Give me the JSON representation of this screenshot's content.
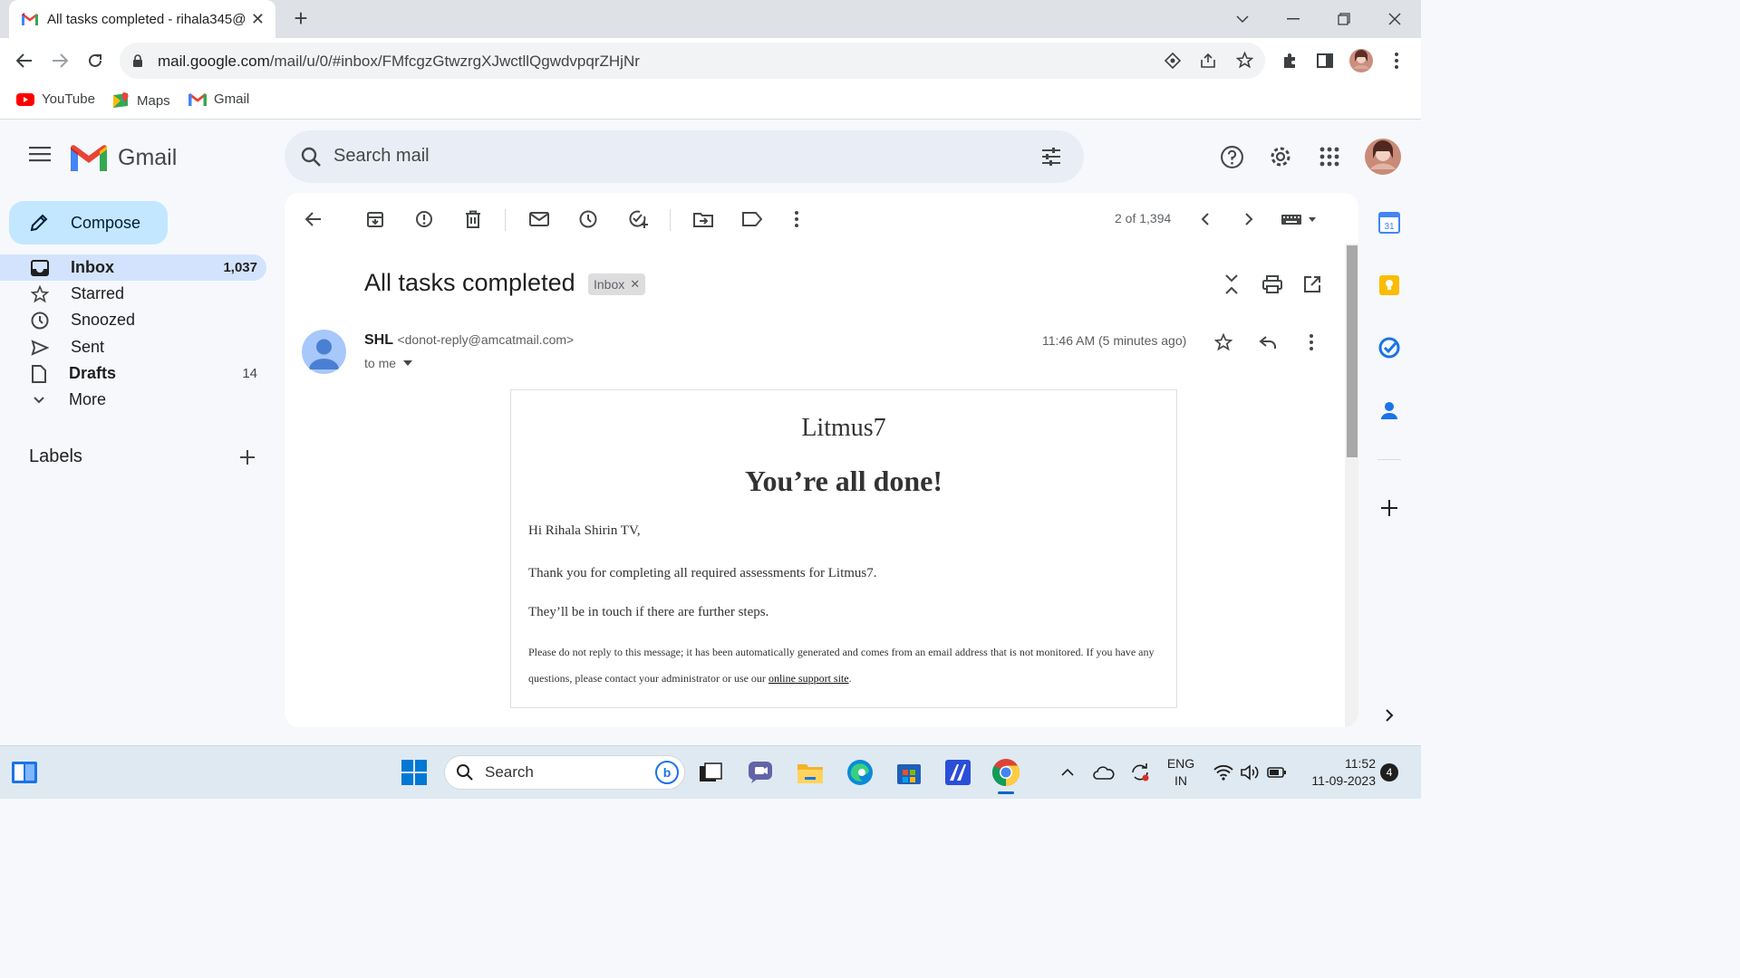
{
  "browser": {
    "tab_title": "All tasks completed - rihala345@",
    "url_host": "mail.google.com",
    "url_path": "/mail/u/0/#inbox/FMfcgzGtwzrgXJwctllQgwdvpqrZHjNr",
    "bookmarks": [
      {
        "label": "YouTube",
        "icon": "youtube-icon"
      },
      {
        "label": "Maps",
        "icon": "maps-icon"
      },
      {
        "label": "Gmail",
        "icon": "gmail-icon"
      }
    ]
  },
  "gmail": {
    "product_name": "Gmail",
    "search_placeholder": "Search mail",
    "compose_label": "Compose",
    "nav": [
      {
        "label": "Inbox",
        "count": "1,037"
      },
      {
        "label": "Starred",
        "count": ""
      },
      {
        "label": "Snoozed",
        "count": ""
      },
      {
        "label": "Sent",
        "count": ""
      },
      {
        "label": "Drafts",
        "count": "14"
      },
      {
        "label": "More",
        "count": ""
      }
    ],
    "labels_heading": "Labels",
    "pager": "2 of 1,394"
  },
  "email": {
    "subject": "All tasks completed",
    "label_chip": "Inbox",
    "sender_name": "SHL",
    "sender_address": "<donot-reply@amcatmail.com>",
    "recipient": "to me",
    "timestamp": "11:46 AM (5 minutes ago)",
    "body": {
      "brand": "Litmus7",
      "heading": "You’re all done!",
      "greeting": "Hi Rihala Shirin TV,",
      "line1": "Thank you for completing all required assessments for Litmus7.",
      "line2": "They’ll be in touch if there are further steps.",
      "footer_text": "Please do not reply to this message; it has been automatically generated and comes from an email address that is not monitored. If you have any questions, please contact your administrator or use our ",
      "footer_link": "online support site",
      "footer_end": "."
    }
  },
  "taskbar": {
    "search_label": "Search",
    "lang_line1": "ENG",
    "lang_line2": "IN",
    "time": "11:52",
    "date": "11-09-2023",
    "notification_count": "4"
  },
  "colors": {
    "accent_blue": "#0b57d0",
    "compose_bg": "#c2e7ff",
    "active_nav_bg": "#d3e3fd"
  }
}
